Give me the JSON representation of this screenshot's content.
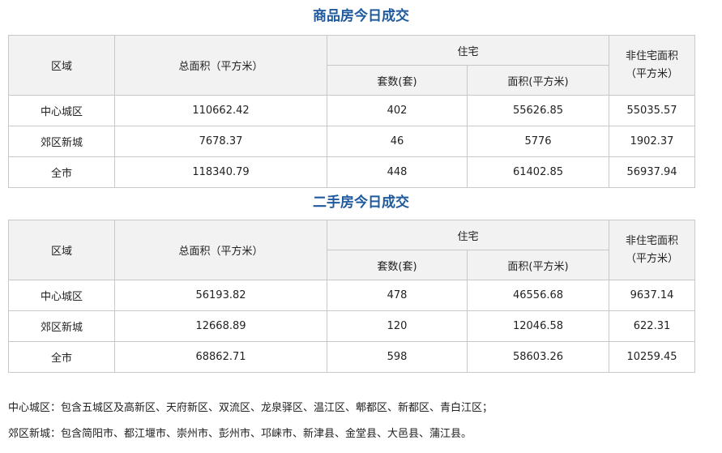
{
  "tables": [
    {
      "title": "商品房今日成交",
      "headers": {
        "region": "区域",
        "total_area": "总面积（平方米）",
        "residential": "住宅",
        "units": "套数(套)",
        "res_area": "面积(平方米)",
        "non_res_line1": "非住宅面积",
        "non_res_line2": "（平方米）"
      },
      "rows": [
        {
          "region": "中心城区",
          "total_area": "110662.42",
          "units": "402",
          "res_area": "55626.85",
          "non_res_area": "55035.57"
        },
        {
          "region": "郊区新城",
          "total_area": "7678.37",
          "units": "46",
          "res_area": "5776",
          "non_res_area": "1902.37"
        },
        {
          "region": "全市",
          "total_area": "118340.79",
          "units": "448",
          "res_area": "61402.85",
          "non_res_area": "56937.94"
        }
      ]
    },
    {
      "title": "二手房今日成交",
      "headers": {
        "region": "区域",
        "total_area": "总面积（平方米）",
        "residential": "住宅",
        "units": "套数(套)",
        "res_area": "面积(平方米)",
        "non_res_line1": "非住宅面积",
        "non_res_line2": "（平方米）"
      },
      "rows": [
        {
          "region": "中心城区",
          "total_area": "56193.82",
          "units": "478",
          "res_area": "46556.68",
          "non_res_area": "9637.14"
        },
        {
          "region": "郊区新城",
          "total_area": "12668.89",
          "units": "120",
          "res_area": "12046.58",
          "non_res_area": "622.31"
        },
        {
          "region": "全市",
          "total_area": "68862.71",
          "units": "598",
          "res_area": "58603.26",
          "non_res_area": "10259.45"
        }
      ]
    }
  ],
  "notes": [
    "中心城区：包含五城区及高新区、天府新区、双流区、龙泉驿区、温江区、郫都区、新都区、青白江区；",
    "郊区新城：包含简阳市、都江堰市、崇州市、彭州市、邛崃市、新津县、金堂县、大邑县、蒲江县。"
  ],
  "colors": {
    "title": "#1f5a9e",
    "header_bg": "#f2f2f2",
    "border": "#c8c8c8"
  }
}
